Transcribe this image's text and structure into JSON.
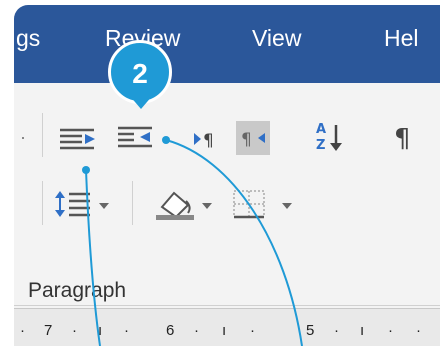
{
  "tabs": [
    {
      "label": "gs"
    },
    {
      "label": "Review"
    },
    {
      "label": "View"
    },
    {
      "label": "Hel"
    }
  ],
  "callout": {
    "number": "2",
    "color": "#1f9ad6"
  },
  "ribbon": {
    "group_label": "Paragraph"
  },
  "ruler": {
    "ticks": [
      "7",
      "6",
      "5"
    ]
  },
  "colors": {
    "tab_bar": "#2b579a",
    "ribbon": "#f3f3f3",
    "accent_blue": "#2f6fc6"
  },
  "icons": [
    "increase-indent-icon",
    "decrease-indent-icon",
    "ltr-direction-icon",
    "rtl-direction-icon",
    "sort-icon",
    "show-marks-icon",
    "line-spacing-icon",
    "shading-icon",
    "borders-icon"
  ]
}
